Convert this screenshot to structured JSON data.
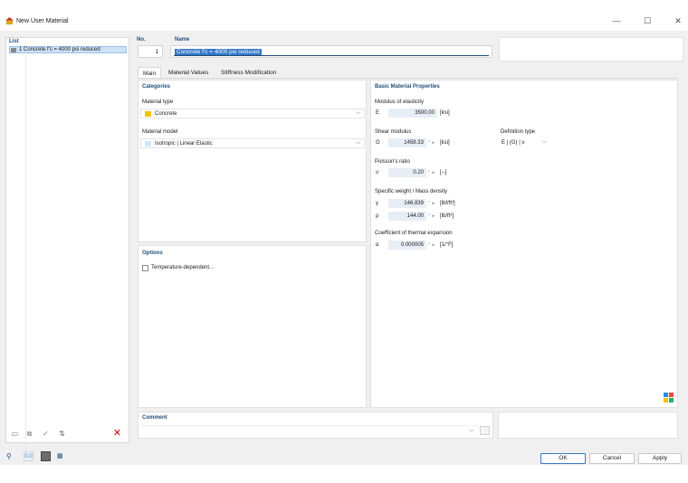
{
  "window": {
    "title": "New User Material",
    "controls": {
      "minimize": "—",
      "maximize": "☐",
      "close": "✕"
    }
  },
  "list": {
    "header": "List",
    "items": [
      {
        "label": "1  Concrete f'c = 4000 psi reduced"
      }
    ]
  },
  "header": {
    "no_label": "No.",
    "no_value": "1",
    "name_label": "Name",
    "name_value": "Concrete f'c = 4000 psi reduced"
  },
  "tabs": [
    {
      "label": "Main",
      "active": true
    },
    {
      "label": "Material Values",
      "active": false
    },
    {
      "label": "Stiffness Modification",
      "active": false
    }
  ],
  "categories": {
    "title": "Categories",
    "material_type_label": "Material type",
    "material_type_value": "Concrete",
    "material_type_color": "#f2c200",
    "material_model_label": "Material model",
    "material_model_value": "Isotropic | Linear Elastic",
    "material_model_color": "#cfe9f7"
  },
  "options": {
    "title": "Options",
    "temperature_dependent": "Temperature-dependent..."
  },
  "basic": {
    "title": "Basic Material Properties",
    "modulus_label": "Modulus of elasticity",
    "E_sym": "E",
    "E_value": "3500.00",
    "E_unit": "[ksi]",
    "shear_label": "Shear modulus",
    "G_sym": "G",
    "G_value": "1458.33",
    "G_unit": "[ksi]",
    "definition_label": "Definition type",
    "definition_value": "E | (G) | ν",
    "poisson_label": "Poisson's ratio",
    "nu_sym": "ν",
    "nu_value": "0.20",
    "nu_unit": "[--]",
    "weight_label": "Specific weight / Mass density",
    "gamma_sym": "γ",
    "gamma_value": "146.839",
    "gamma_unit": "[lbf/ft³]",
    "rho_sym": "ρ",
    "rho_value": "144.00",
    "rho_unit": "[lb/ft³]",
    "thermal_label": "Coefficient of thermal expansion",
    "alpha_sym": "α",
    "alpha_value": "0.000005",
    "alpha_unit": "[1/°F]"
  },
  "comment": {
    "title": "Comment"
  },
  "buttons": {
    "ok": "OK",
    "cancel": "Cancel",
    "apply": "Apply"
  },
  "icons": {
    "app": "material-icon",
    "spin": "spin-arrows",
    "chevron": "chevron-down-icon"
  }
}
